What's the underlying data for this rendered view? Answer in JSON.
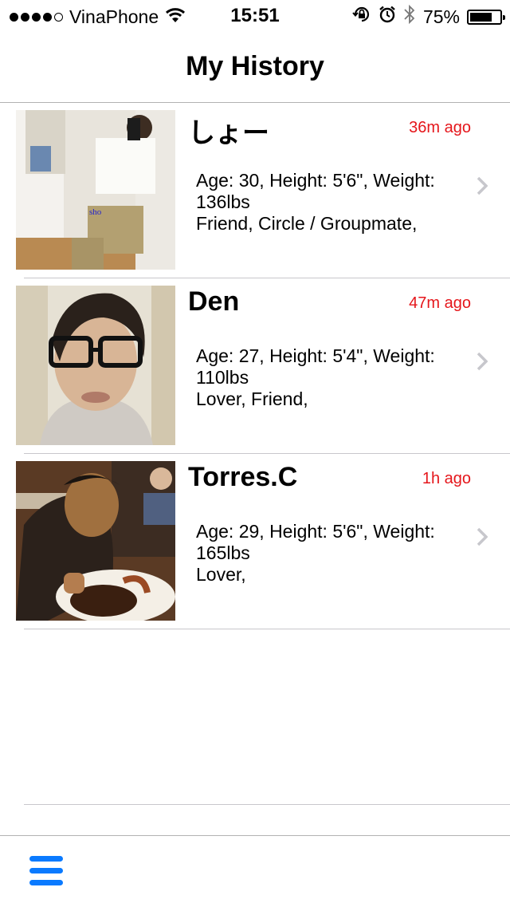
{
  "status_bar": {
    "carrier": "VinaPhone",
    "time": "15:51",
    "battery": "75%",
    "battery_level": 0.75
  },
  "nav": {
    "title": "My History"
  },
  "history": [
    {
      "name": "しょー",
      "time": "36m ago",
      "stats": "Age: 30, Height: 5'6\", Weight: 136lbs",
      "relation": "Friend, Circle / Groupmate,",
      "photo_caption": "sho"
    },
    {
      "name": "Den",
      "time": "47m ago",
      "stats": "Age: 27, Height: 5'4\", Weight: 110lbs",
      "relation": "Lover, Friend,"
    },
    {
      "name": "Torres.C",
      "time": "1h ago",
      "stats": "Age: 29, Height: 5'6\", Weight: 165lbs",
      "relation": "Lover,"
    }
  ],
  "colors": {
    "accent": "#0a7aff",
    "time_red": "#e5161b"
  },
  "icons": [
    "wifi-icon",
    "rotation-lock-icon",
    "alarm-icon",
    "bluetooth-icon",
    "battery-icon",
    "chevron-right-icon",
    "menu-icon"
  ]
}
